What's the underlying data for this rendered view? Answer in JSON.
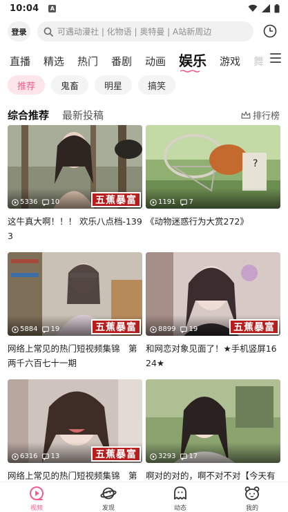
{
  "status": {
    "time": "10:04",
    "badge": "A"
  },
  "header": {
    "login_label": "登录",
    "search_placeholder": "可遇动漫社 | 化物语 | 奥特曼 | A站新周边"
  },
  "channels": [
    {
      "label": "直播"
    },
    {
      "label": "精选"
    },
    {
      "label": "热门"
    },
    {
      "label": "番剧"
    },
    {
      "label": "动画"
    },
    {
      "label": "娱乐",
      "active": true
    },
    {
      "label": "游戏"
    },
    {
      "label": "舞"
    }
  ],
  "tags": [
    {
      "label": "推荐",
      "active": true
    },
    {
      "label": "鬼畜"
    },
    {
      "label": "明星"
    },
    {
      "label": "搞笑"
    }
  ],
  "feed": {
    "sort_tabs": [
      "综合推荐",
      "最新投稿"
    ],
    "rank_label": "排行榜"
  },
  "watermark_text": "五蕉暴富",
  "videos": [
    {
      "views": "5336",
      "comments": "10",
      "title": "这牛真大啊！！！ 欢乐八点档-1393",
      "has_watermark": true
    },
    {
      "views": "1191",
      "comments": "7",
      "title": "《动物迷惑行为大赏272》",
      "has_watermark": false
    },
    {
      "views": "5884",
      "comments": "19",
      "title": "网络上常见的热门短视频集锦　第两千六百七十一期",
      "has_watermark": true
    },
    {
      "views": "8899",
      "comments": "19",
      "title": "和网恋对象见面了！★手机竖屏1624★",
      "has_watermark": true
    },
    {
      "views": "6316",
      "comments": "13",
      "title": "网络上常见的热门短视频集锦　第",
      "has_watermark": true
    },
    {
      "views": "3293",
      "comments": "17",
      "title": "啊对的对的，啊不对不对【今天有",
      "has_watermark": false
    }
  ],
  "bottom_nav": [
    {
      "label": "视频",
      "icon": "video-icon",
      "active": true
    },
    {
      "label": "发现",
      "icon": "planet-icon"
    },
    {
      "label": "动态",
      "icon": "ghost-icon"
    },
    {
      "label": "我的",
      "icon": "bear-icon"
    }
  ],
  "colors": {
    "accent": "#f25d8e",
    "watermark_bg": "#b81d1d"
  }
}
